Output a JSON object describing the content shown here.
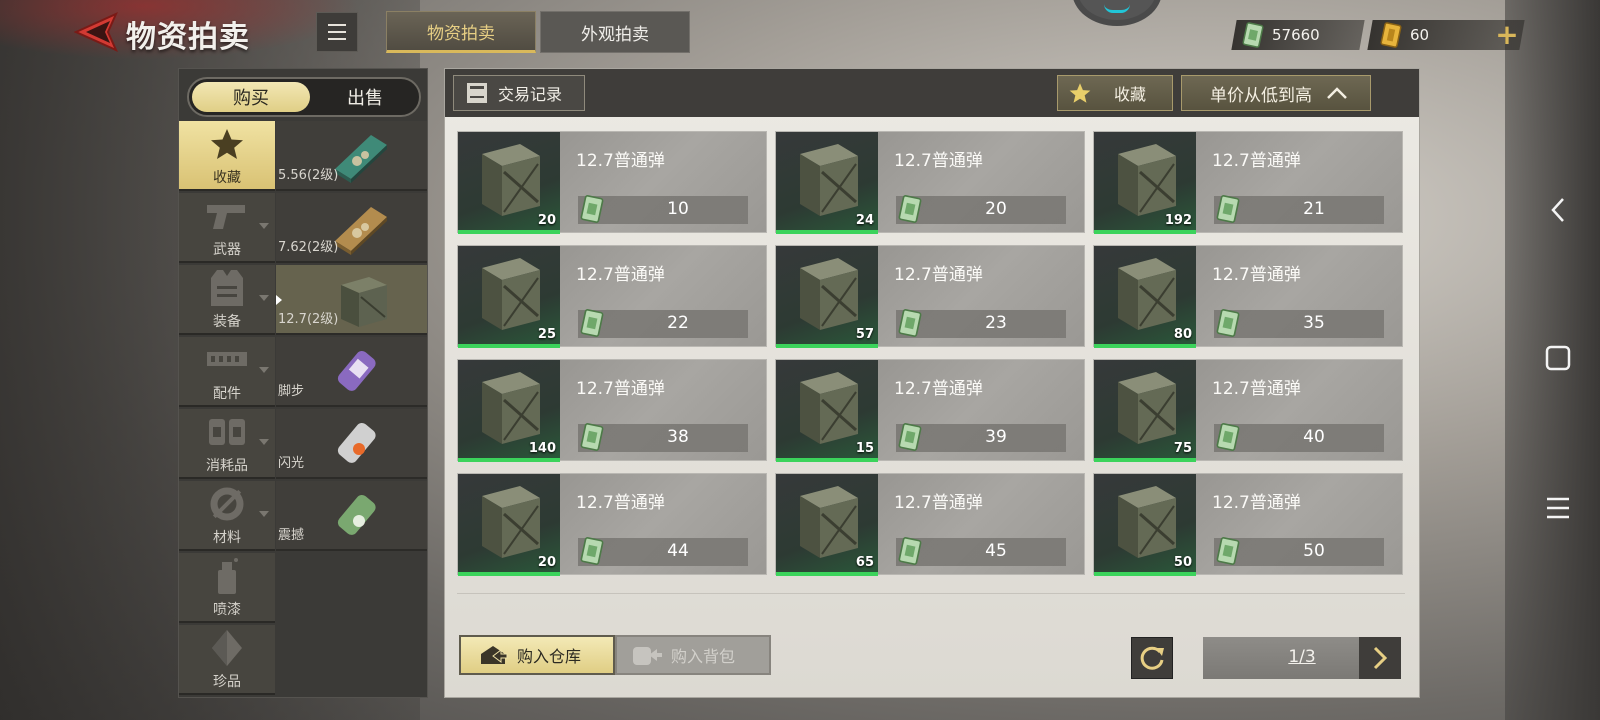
{
  "header": {
    "title": "物资拍卖",
    "tabs": [
      {
        "label": "物资拍卖",
        "active": true
      },
      {
        "label": "外观拍卖",
        "active": false
      }
    ],
    "currency": {
      "cash": "57660",
      "gold": "60"
    }
  },
  "sidebar": {
    "segment": {
      "buy": "购买",
      "sell": "出售"
    },
    "categories": [
      {
        "label": "收藏",
        "icon": "star-icon",
        "active": true
      },
      {
        "label": "武器",
        "icon": "pistol-icon"
      },
      {
        "label": "装备",
        "icon": "vest-icon"
      },
      {
        "label": "配件",
        "icon": "attachment-icon"
      },
      {
        "label": "消耗品",
        "icon": "bandage-icon"
      },
      {
        "label": "材料",
        "icon": "wrench-gear-icon"
      },
      {
        "label": "喷漆",
        "icon": "spray-can-icon"
      },
      {
        "label": "珍品",
        "icon": "diamond-icon"
      }
    ],
    "subitems": [
      {
        "label": "5.56(2级)"
      },
      {
        "label": "7.62(2级)"
      },
      {
        "label": "12.7(2级)",
        "active": true
      },
      {
        "label": "脚步"
      },
      {
        "label": "闪光"
      },
      {
        "label": "震撼"
      }
    ]
  },
  "toolbar": {
    "records_label": "交易记录",
    "favorite_label": "收藏",
    "sort_label": "单价从低到高"
  },
  "listings": [
    {
      "name": "12.7普通弹",
      "qty": "20",
      "price": "10"
    },
    {
      "name": "12.7普通弹",
      "qty": "24",
      "price": "20"
    },
    {
      "name": "12.7普通弹",
      "qty": "192",
      "price": "21"
    },
    {
      "name": "12.7普通弹",
      "qty": "25",
      "price": "22"
    },
    {
      "name": "12.7普通弹",
      "qty": "57",
      "price": "23"
    },
    {
      "name": "12.7普通弹",
      "qty": "80",
      "price": "35"
    },
    {
      "name": "12.7普通弹",
      "qty": "140",
      "price": "38"
    },
    {
      "name": "12.7普通弹",
      "qty": "15",
      "price": "39"
    },
    {
      "name": "12.7普通弹",
      "qty": "75",
      "price": "40"
    },
    {
      "name": "12.7普通弹",
      "qty": "20",
      "price": "44"
    },
    {
      "name": "12.7普通弹",
      "qty": "65",
      "price": "45"
    },
    {
      "name": "12.7普通弹",
      "qty": "50",
      "price": "50"
    }
  ],
  "footer": {
    "buy_warehouse": "购入仓库",
    "buy_backpack": "购入背包",
    "page": "1/3"
  },
  "colors": {
    "accent_gold": "#e0ce84",
    "qty_bar": "#3bd35b",
    "panel_dark": "#3f3d3a"
  }
}
